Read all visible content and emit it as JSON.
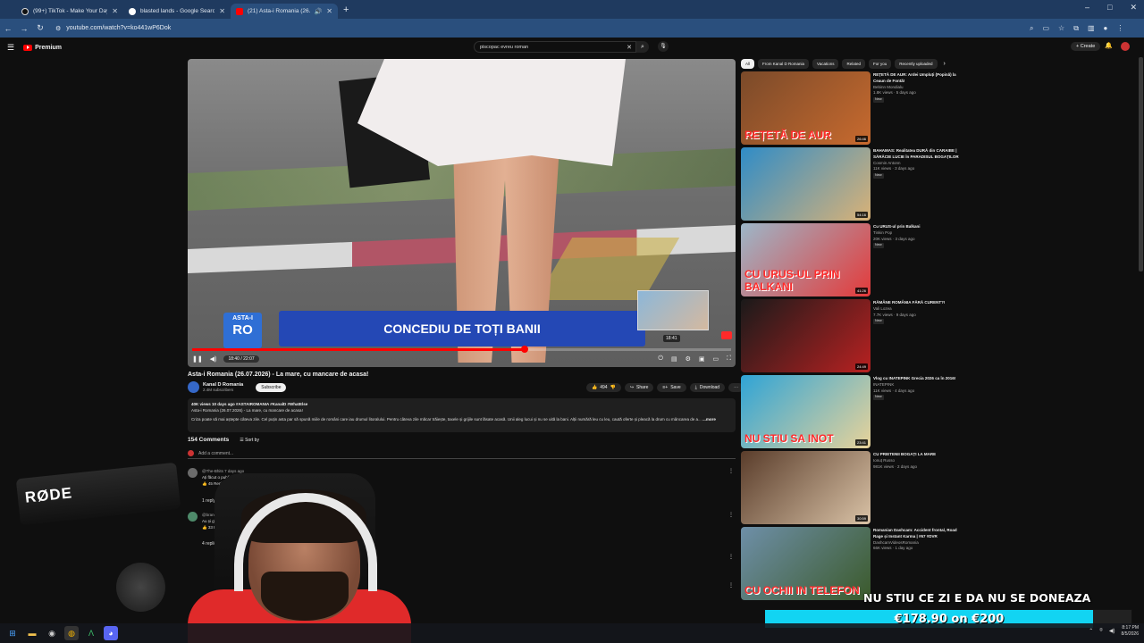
{
  "browser": {
    "tabs": [
      {
        "title": "(99+) TikTok - Make Your Day",
        "active": false,
        "favicon_color": "#111111"
      },
      {
        "title": "blasted lands - Google Search",
        "active": false,
        "favicon_color": "#ffffff"
      },
      {
        "title": "(21) Asta-i Romania (26.07.",
        "active": true,
        "favicon_color": "#ff0000"
      }
    ],
    "new_tab": "+",
    "window_controls": [
      "–",
      "□",
      "✕"
    ],
    "url": "youtube.com/watch?v=ko441wP6Dok"
  },
  "youtube": {
    "logo_text": "Premium",
    "search_value": "piscopac evreu roman",
    "create_label": "Create",
    "player": {
      "banner_text": "CONCEDIU DE TOȚI BANII",
      "logo_top": "ASTA-I",
      "logo_main": "RO",
      "preview_time": "18:41",
      "time_display": "18:40 / 22:07",
      "progress": 0.617
    },
    "video": {
      "title": "Asta-i Romania (26.07.2026) - La mare, cu mancare de acasa!",
      "channel_name": "Kanal D Romania",
      "channel_subs": "2.4M subscribers",
      "subscribe_label": "Subscribe",
      "likes": "494",
      "share_label": "Share",
      "save_label": "Save",
      "download_label": "Download",
      "desc_meta": "40K views  10 days ago  #ASTAIROMANIA #KanalD #WhatElse",
      "desc_line1": "Asta-i Romania (26.07.2026) - La mare, cu mancare de acasa!",
      "desc_line2": "Criza poate să mai aștepte câteva zile. Cel puțin asta par să spună miile de români care iau drumul litoralului. Pentru câteva zile măcar trăiește, taxele și grijile sunt lăsate acasă. Unii aleg lucui și nu se uită la bani. Alții numără leu cu leu, caută oferte și pleacă la drum cu mâncarea de a...",
      "more_label": "...more"
    },
    "comments": {
      "count_label": "154 Comments",
      "sort_label": "Sort by",
      "add_placeholder": "Add a comment...",
      "items": [
        {
          "author": "@The-Bhits  7 days ago",
          "text": "Ați făcut o publicitate la 6b... ...le porumbei",
          "likes": "45",
          "reply": "Reply"
        },
        {
          "author": "@brandFm038  8 days ago",
          "text": "Au și gîbali pe care...",
          "likes": "33",
          "reply": "Reply"
        }
      ],
      "reply_counts": [
        "1 reply",
        "4 replies"
      ]
    },
    "chips": [
      "All",
      "From Kanal D Romania",
      "Vacations",
      "Related",
      "For you",
      "Recently uploaded"
    ],
    "recommendations": [
      {
        "title": "REȚETĂ DE AUR: Ardei Umpluți (Popină) la Ceaun de Fontă!",
        "channel": "Bebinn Mondialu",
        "views": "1.8K views · 5 days ago",
        "duration": "26:46",
        "overlay": "REȚETĂ DE AUR",
        "badge": "New",
        "colors": [
          "#7a4a2a",
          "#c86a2e"
        ]
      },
      {
        "title": "BAHAMAS: Realitatea DURĂ din CARAIBE | SĂRĂCIE LUCIE în PARADISUL BOGAȚILOR",
        "channel": "Cosmin Antonn",
        "views": "11K views · 3 days ago",
        "duration": "54:16",
        "overlay": "",
        "badge": "New",
        "colors": [
          "#2f8cc7",
          "#d9b277"
        ]
      },
      {
        "title": "Cu URUS-ul prin Balkani",
        "channel": "Tinkin Pop",
        "views": "20K views · 3 days ago",
        "duration": "41:26",
        "overlay": "CU URUS-UL PRIN BALKANI",
        "badge": "New",
        "colors": [
          "#9cb7c9",
          "#e43a3a"
        ]
      },
      {
        "title": "RĂMÂNE ROMÂNIA FĂRĂ CURENT?!",
        "channel": "Vali Lozea",
        "views": "7.7K views · 9 days ago",
        "duration": "24:49",
        "overlay": "",
        "badge": "New",
        "colors": [
          "#1a1a1a",
          "#b82121"
        ]
      },
      {
        "title": "Vlog cu INATEPINK Grecia 2026 ca în 2016!",
        "channel": "INATEPINK",
        "views": "11K views · 4 days ago",
        "duration": "23:41",
        "overlay": "NU STIU SA INOT",
        "badge": "New",
        "colors": [
          "#2fa4d6",
          "#e8d39a"
        ]
      },
      {
        "title": "CU PRIETENII BOGAȚI LA MARE",
        "channel": "Ionuț Russo",
        "views": "981K views · 2 days ago",
        "duration": "30:59",
        "overlay": "",
        "badge": "",
        "colors": [
          "#5a3d2b",
          "#d9c2a6"
        ]
      },
      {
        "title": "Romanian Dashcam: Accident frontal, Road Rage și Instant Karma | #67 #DVR",
        "channel": "DashcamVideosRomania",
        "views": "66K views · 1 day ago",
        "duration": "",
        "overlay": "CU OCHII IN TELEFON",
        "badge": "",
        "colors": [
          "#6e8fa8",
          "#3b5a2b"
        ]
      }
    ]
  },
  "stream_overlay": {
    "mic_brand": "RØDE",
    "donation_text": "NU STIU CE ZI E DA NU SE DONEAZA",
    "donation_amount": "€178.90 on €200",
    "donation_progress": 0.8945
  },
  "taskbar": {
    "time": "8:17 PM",
    "date": "8/5/2026"
  }
}
